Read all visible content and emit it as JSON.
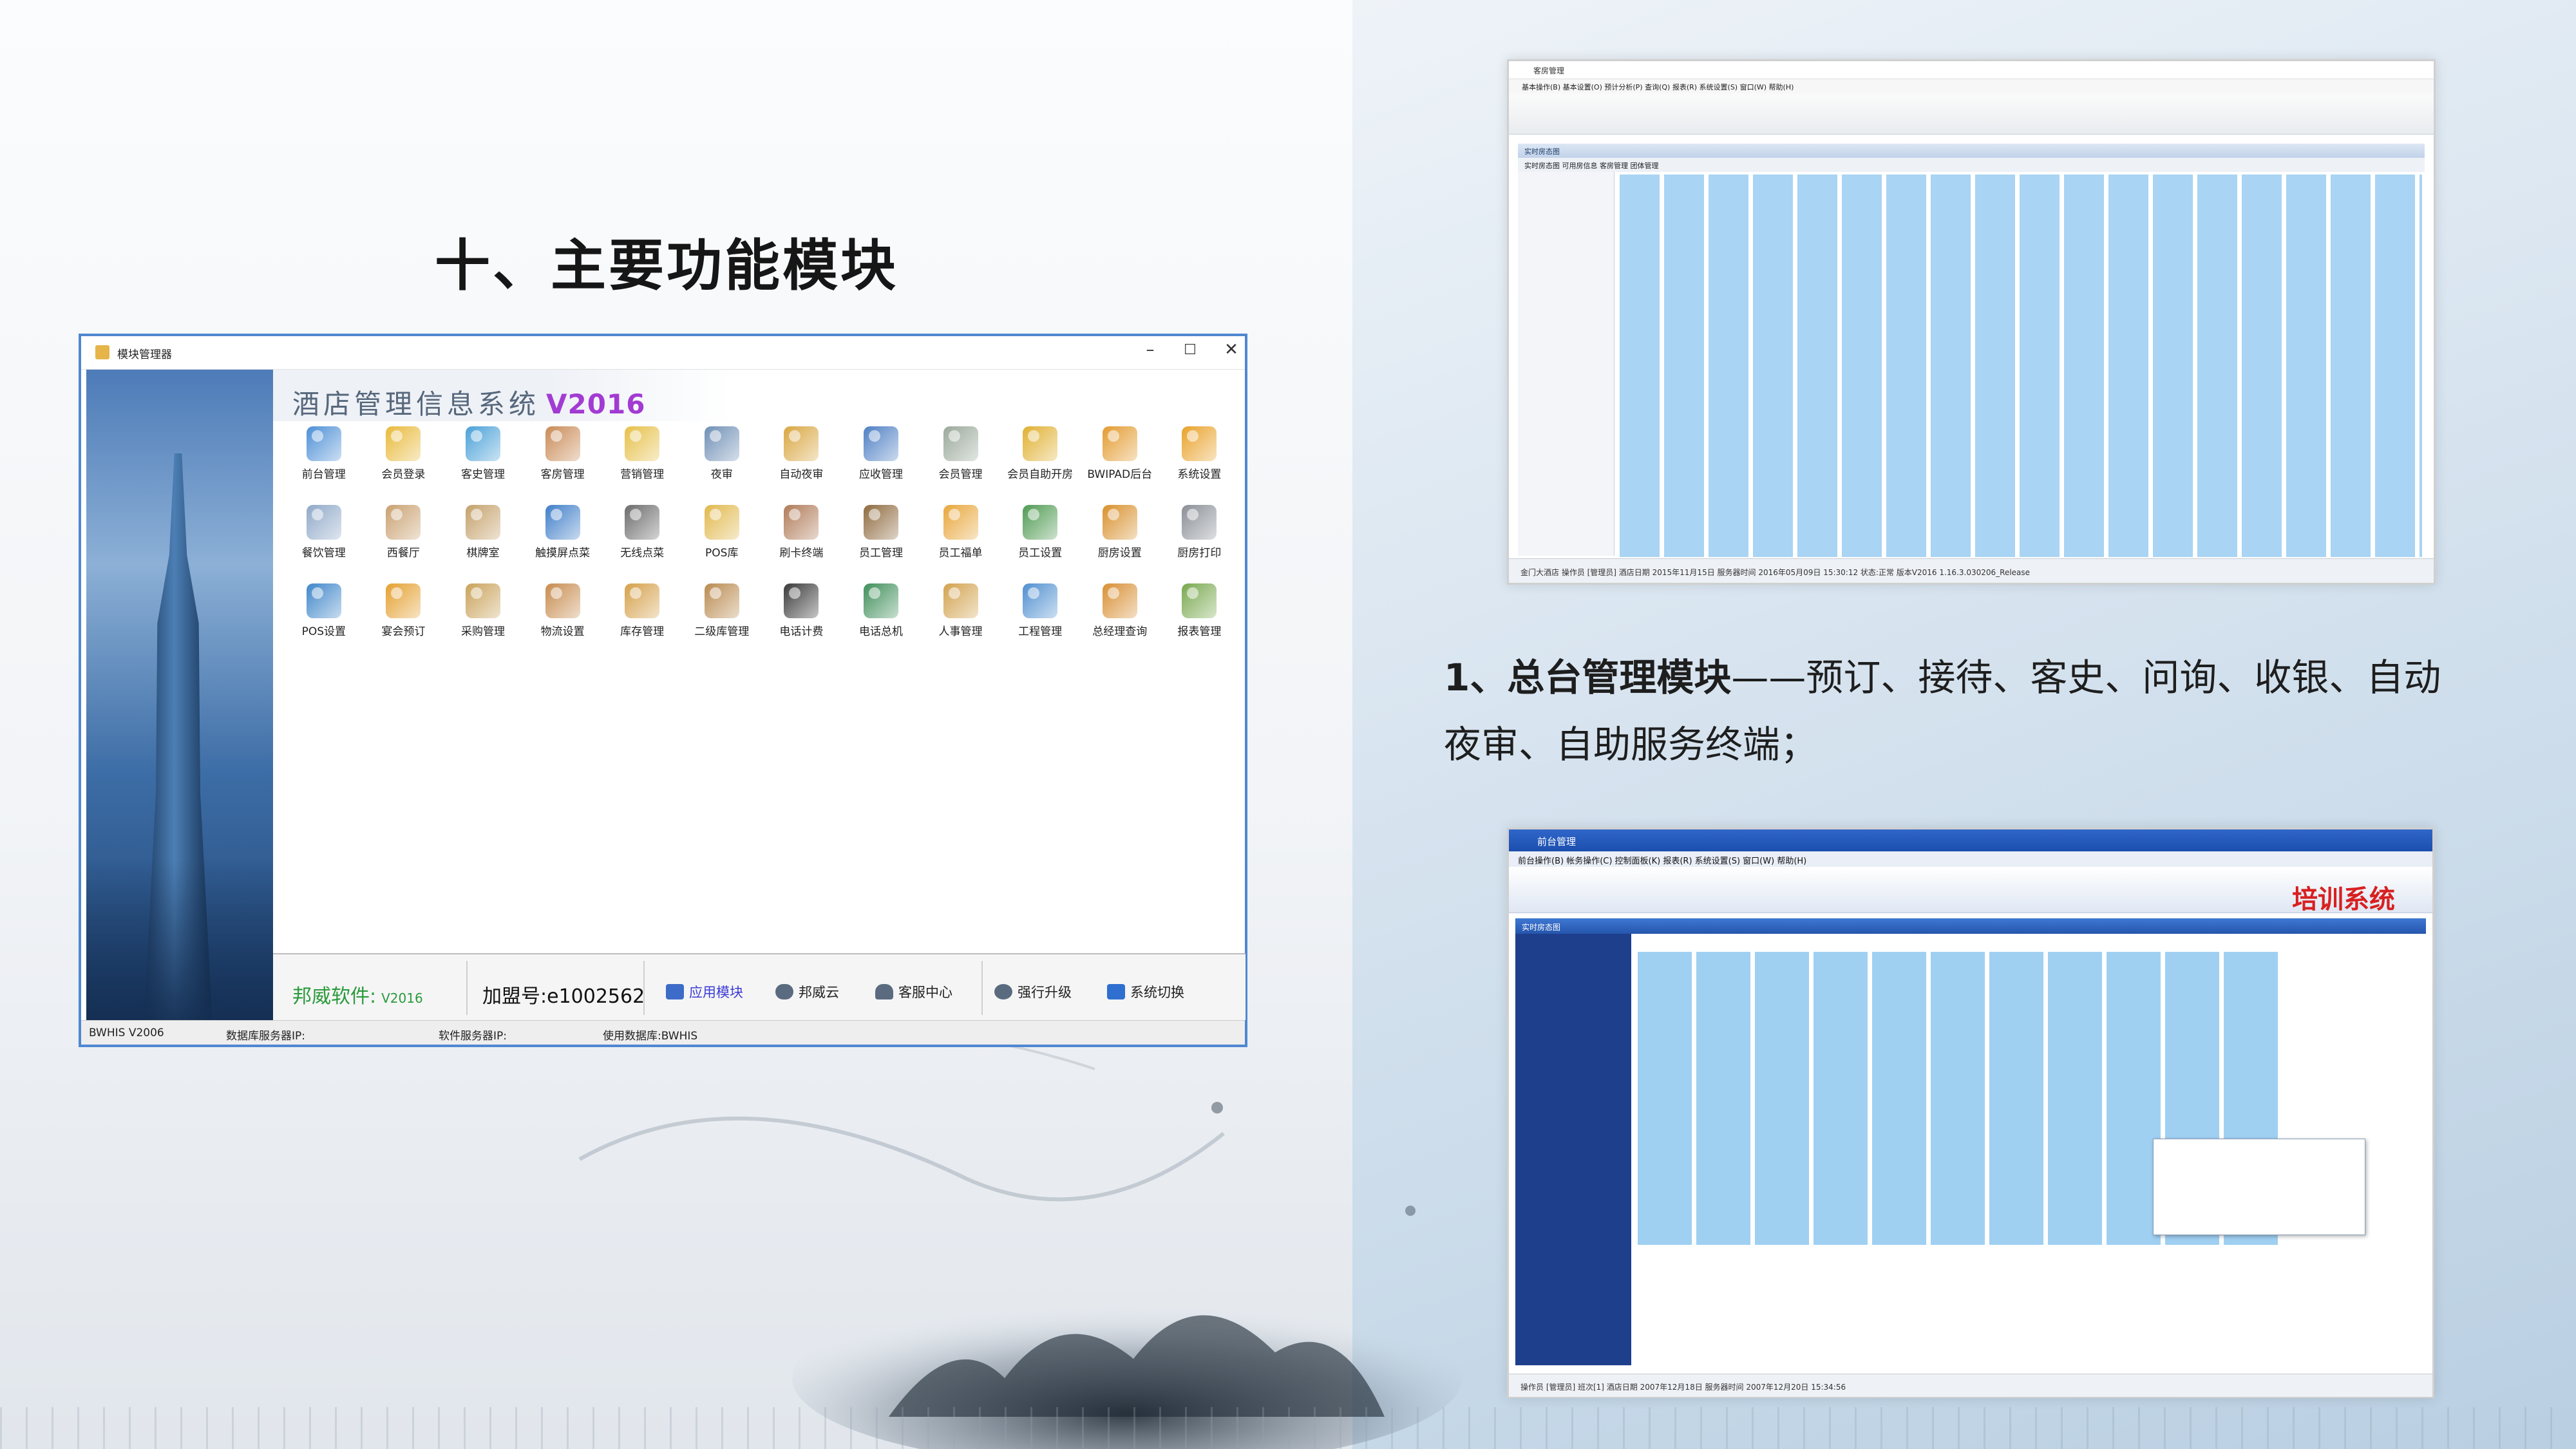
{
  "section_title": "十、主要功能模块",
  "module_window": {
    "title": "模块管理器",
    "banner": {
      "name": "酒店管理信息系统",
      "version": "V2016"
    },
    "modules": [
      {
        "label": "前台管理",
        "icon": "monitor-icon",
        "color": "#4d8fd6"
      },
      {
        "label": "会员登录",
        "icon": "stars-icon",
        "color": "#e8b93a"
      },
      {
        "label": "客史管理",
        "icon": "people-icon",
        "color": "#4aa0d8"
      },
      {
        "label": "客房管理",
        "icon": "tools-icon",
        "color": "#c98a55"
      },
      {
        "label": "营销管理",
        "icon": "folder-icon",
        "color": "#e6c048"
      },
      {
        "label": "夜审",
        "icon": "search-doc-icon",
        "color": "#6f8fb5"
      },
      {
        "label": "自动夜审",
        "icon": "clock-icon",
        "color": "#d9a640"
      },
      {
        "label": "应收管理",
        "icon": "transfer-icon",
        "color": "#4e7fc4"
      },
      {
        "label": "会员管理",
        "icon": "card-icon",
        "color": "#9aa89a"
      },
      {
        "label": "会员自助开房",
        "icon": "stars-icon",
        "color": "#e0b030"
      },
      {
        "label": "BWIPAD后台",
        "icon": "gear-icon",
        "color": "#e39b2f"
      },
      {
        "label": "系统设置",
        "icon": "gear-icon",
        "color": "#e9a22a"
      },
      {
        "label": "餐饮管理",
        "icon": "fork-icon",
        "color": "#8fa8c8"
      },
      {
        "label": "西餐厅",
        "icon": "fork-icon",
        "color": "#c9a070"
      },
      {
        "label": "棋牌室",
        "icon": "fork-icon",
        "color": "#c4a06a"
      },
      {
        "label": "触摸屏点菜",
        "icon": "touch-icon",
        "color": "#3f7ec8"
      },
      {
        "label": "无线点菜",
        "icon": "phone-icon",
        "color": "#6b6b6b"
      },
      {
        "label": "POS库",
        "icon": "checklist-icon",
        "color": "#e1b84c"
      },
      {
        "label": "刷卡终端",
        "icon": "card-reader-icon",
        "color": "#b07a58"
      },
      {
        "label": "员工管理",
        "icon": "staff-icon",
        "color": "#8e6a3f"
      },
      {
        "label": "员工福单",
        "icon": "hands-icon",
        "color": "#e8a63a"
      },
      {
        "label": "员工设置",
        "icon": "person-icon",
        "color": "#4f9a52"
      },
      {
        "label": "厨房设置",
        "icon": "books-icon",
        "color": "#d8902c"
      },
      {
        "label": "厨房打印",
        "icon": "printer-icon",
        "color": "#8a8f96"
      },
      {
        "label": "POS设置",
        "icon": "pos-icon",
        "color": "#3f86c9"
      },
      {
        "label": "宴会预订",
        "icon": "gear-icon",
        "color": "#e4a030"
      },
      {
        "label": "采购管理",
        "icon": "box-icon",
        "color": "#c9a25a"
      },
      {
        "label": "物流设置",
        "icon": "box-icon",
        "color": "#c78b4e"
      },
      {
        "label": "库存管理",
        "icon": "box-icon",
        "color": "#d5a04a"
      },
      {
        "label": "二级库管理",
        "icon": "box-icon",
        "color": "#b98a4f"
      },
      {
        "label": "电话计费",
        "icon": "telephone-icon",
        "color": "#3a3a3a"
      },
      {
        "label": "电话总机",
        "icon": "globe-icon",
        "color": "#3f8f5a"
      },
      {
        "label": "人事管理",
        "icon": "document-icon",
        "color": "#d2a24e"
      },
      {
        "label": "工程管理",
        "icon": "grid-icon",
        "color": "#4f8fd0"
      },
      {
        "label": "总经理查询",
        "icon": "chart-icon",
        "color": "#d88f34"
      },
      {
        "label": "报表管理",
        "icon": "report-icon",
        "color": "#78a84e"
      }
    ],
    "footer": {
      "brand": "邦威软件:",
      "brand_version": "V2016",
      "join_no": "加盟号:e1002562",
      "actions": [
        "应用模块",
        "邦威云",
        "客服中心",
        "强行升级",
        "系统切换"
      ]
    },
    "statusbar": [
      "BWHIS V2006",
      "数据库服务器IP:",
      "软件服务器IP:",
      "使用数据库:BWHIS"
    ]
  },
  "room_window": {
    "title": "客房管理",
    "menu": "基本操作(B)  基本设置(O)  预计分析(P)  查询(Q)  报表(R)  系统设置(S)  窗口(W)  帮助(H)",
    "panel_header": "实时房态图",
    "tabs": "实时房态图  可用房信息  客房管理  团体管理",
    "status": "金门大酒店          操作员 [管理员]          酒店日期 2015年11月15日  服务器时间 2016年05月09日 15:30:12          状态:正常          版本V2016 1.16.3.030206_Release"
  },
  "description": {
    "heading": "1、总台管理模块",
    "dash": "——",
    "text_line1": "预订、接待、客史、问询、收银、自动",
    "text_line2": "夜审、自助服务终端；"
  },
  "front_window": {
    "title": "前台管理",
    "menu": "前台操作(B)  帐务操作(C)  控制面板(K)  报表(R)  系统设置(S)  窗口(W)  帮助(H)",
    "training_label": "培训系统",
    "panel_header": "实时房态图",
    "status": "操作员 [管理员]          班次[1]          酒店日期 2007年12月18日          服务器时间 2007年12月20日 15:34:56"
  }
}
